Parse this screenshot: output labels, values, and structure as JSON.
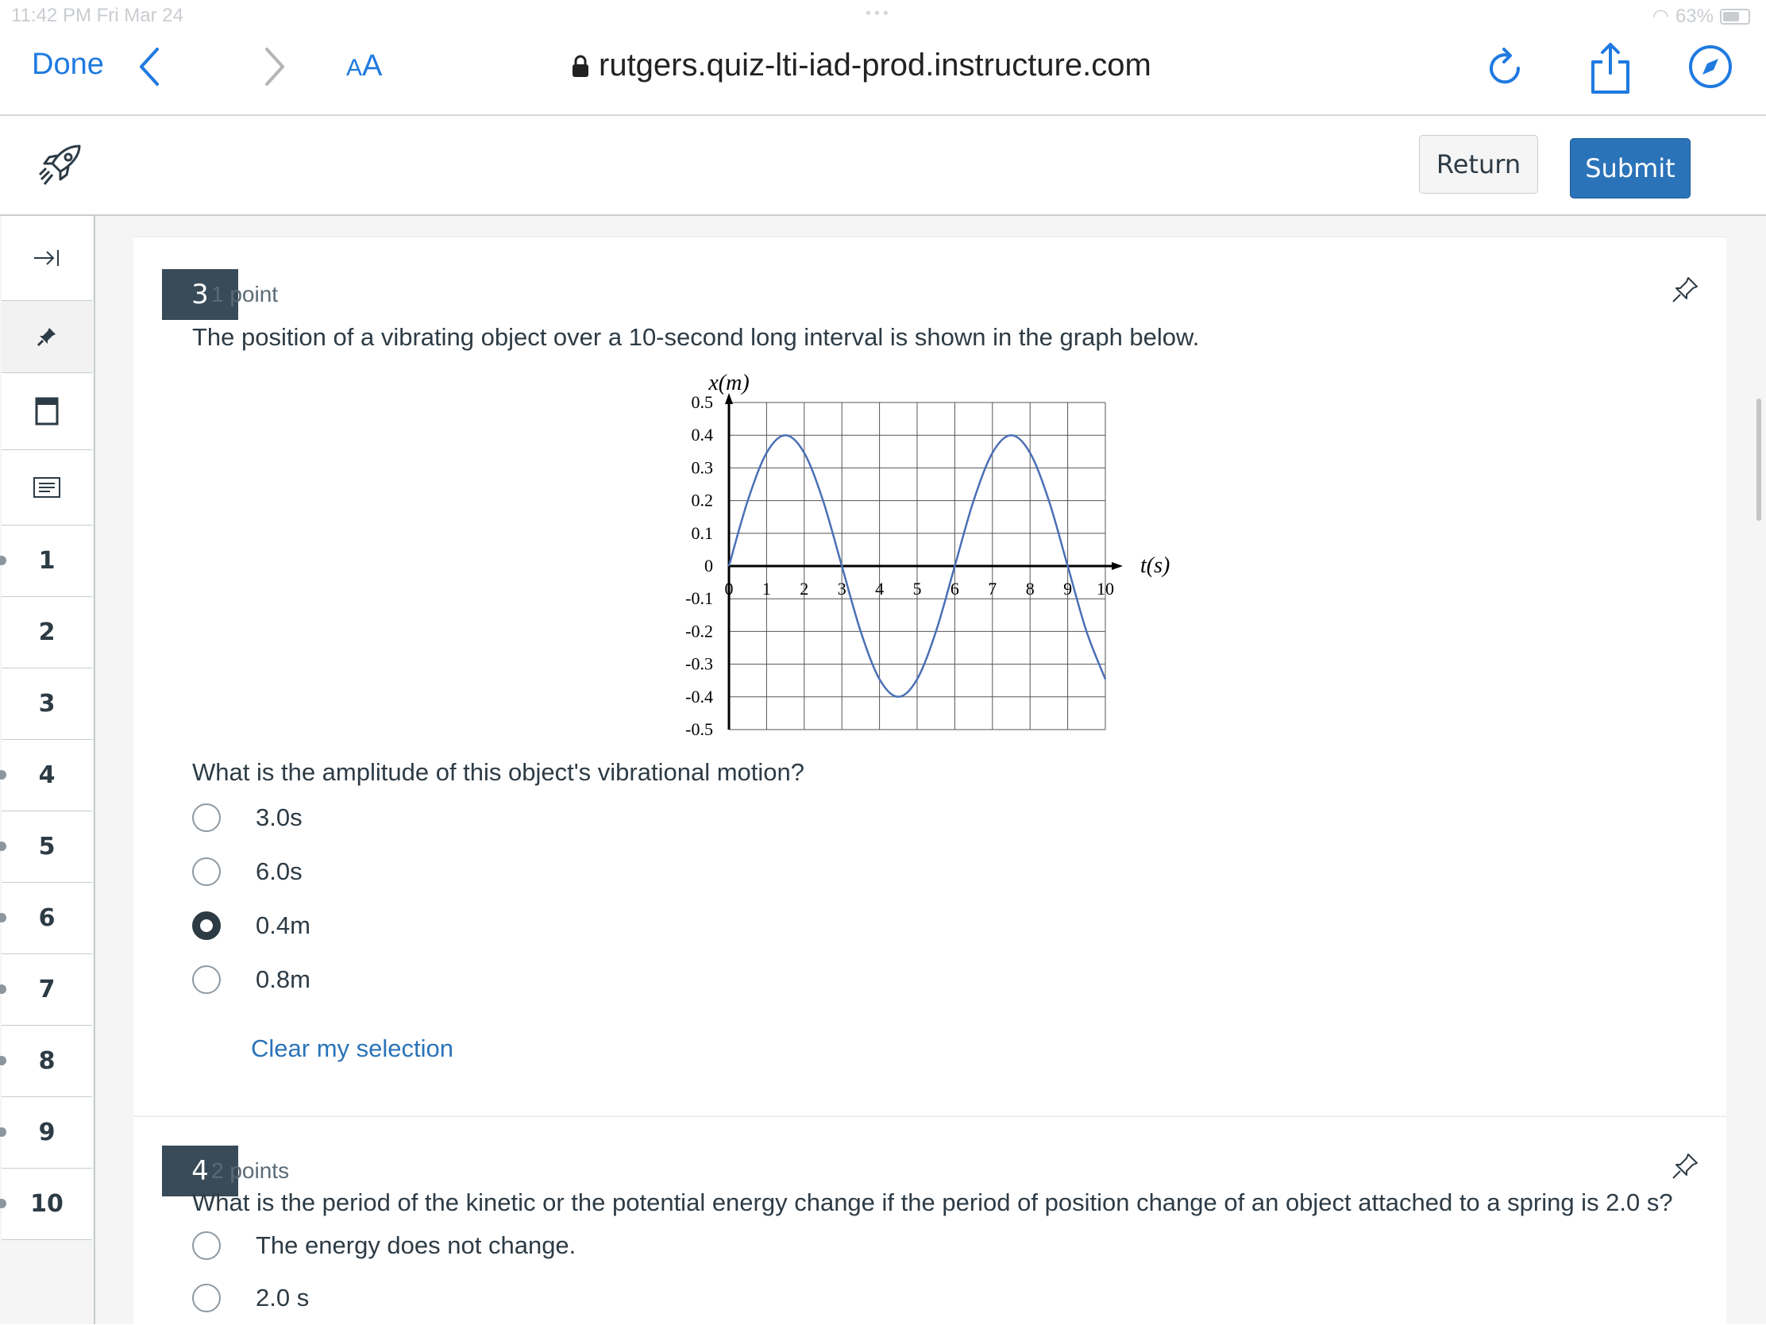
{
  "status_bar": {
    "time": "11:42 PM  Fri Mar 24",
    "battery": "63%"
  },
  "browser": {
    "done_label": "Done",
    "text_size_a1": "A",
    "text_size_a2": "A",
    "url": "rutgers.quiz-lti-iad-prod.instructure.com",
    "icons": [
      "chevron-left-icon",
      "chevron-right-icon",
      "lock-icon",
      "reload-icon",
      "share-icon",
      "compass-icon"
    ]
  },
  "header": {
    "return_label": "Return",
    "submit_label": "Submit",
    "submit_color": "#2b73b9"
  },
  "sidebar": {
    "numbers": [
      "1",
      "2",
      "3",
      "4",
      "5",
      "6",
      "7",
      "8",
      "9",
      "10"
    ]
  },
  "questions": [
    {
      "number": "3",
      "points": "1 point",
      "prompt": "The position of a vibrating object over a 10-second long interval is shown in the graph below.",
      "question": "What is the amplitude of this object's vibrational motion?",
      "options": [
        "3.0s",
        "6.0s",
        "0.4m",
        "0.8m"
      ],
      "selected_index": 2,
      "clear_label": "Clear my selection"
    },
    {
      "number": "4",
      "points": "2 points",
      "prompt": "What is the period of the kinetic or the potential energy change if the period of position change of an object attached to a spring is 2.0 s?",
      "options": [
        "The energy does not change.",
        "2.0 s"
      ]
    }
  ],
  "chart_data": {
    "type": "line",
    "xlabel": "t(s)",
    "ylabel": "x(m)",
    "xlim": [
      0,
      10
    ],
    "ylim": [
      -0.5,
      0.5
    ],
    "x_ticks": [
      "0",
      "1",
      "2",
      "3",
      "4",
      "5",
      "6",
      "7",
      "8",
      "9",
      "10"
    ],
    "y_ticks": [
      "0.5",
      "0.4",
      "0.3",
      "0.2",
      "0.1",
      "0",
      "-0.1",
      "-0.2",
      "-0.3",
      "-0.4",
      "-0.5"
    ],
    "grid": true,
    "series": [
      {
        "color": "#4a6fb5",
        "x": [
          0,
          0.5,
          1,
          1.5,
          2,
          2.5,
          3,
          3.5,
          4,
          4.5,
          5,
          5.5,
          6,
          6.5,
          7,
          7.5,
          8,
          8.5,
          9,
          9.5,
          10
        ],
        "y": [
          0,
          0.2,
          0.346,
          0.4,
          0.346,
          0.2,
          0,
          -0.2,
          -0.346,
          -0.4,
          -0.346,
          -0.2,
          0,
          0.2,
          0.346,
          0.4,
          0.346,
          0.2,
          0,
          -0.2,
          -0.346
        ]
      }
    ]
  }
}
